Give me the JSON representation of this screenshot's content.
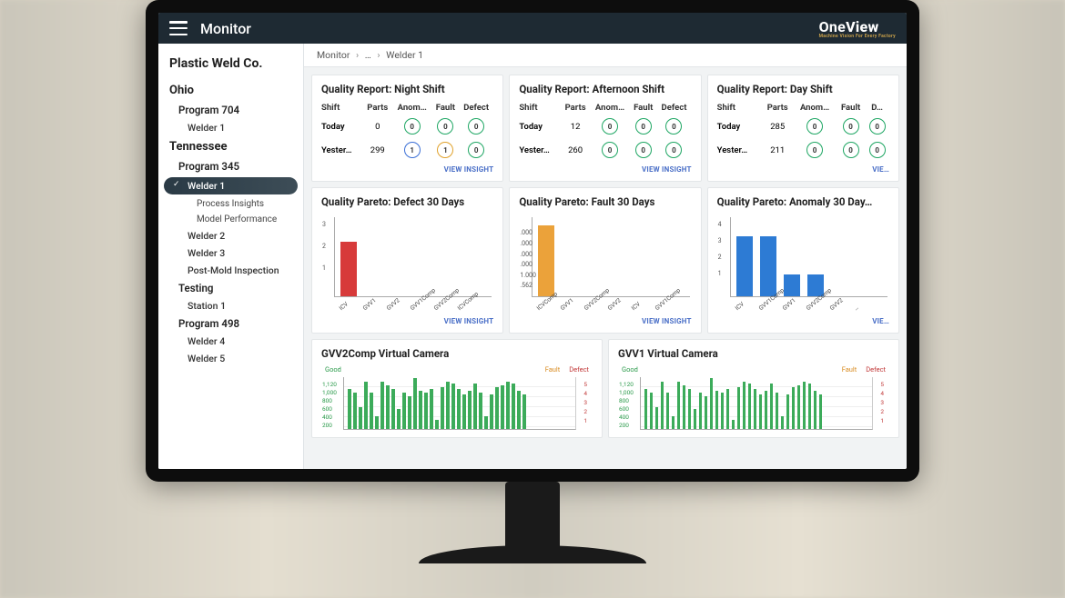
{
  "topbar": {
    "title": "Monitor",
    "brand_prefix": "One",
    "brand_suffix": "View",
    "brand_tag": "Machine Vision For Every Factory"
  },
  "company": "Plastic Weld Co.",
  "tree": {
    "ohio": {
      "label": "Ohio",
      "program704": "Program 704",
      "welder1": "Welder 1"
    },
    "tennessee": {
      "label": "Tennessee",
      "program345": "Program 345",
      "welder1": "Welder 1",
      "process_insights": "Process Insights",
      "model_performance": "Model Performance",
      "welder2": "Welder 2",
      "welder3": "Welder 3",
      "post_mold": "Post-Mold Inspection",
      "testing": "Testing",
      "station1": "Station 1",
      "program498": "Program 498",
      "welder4": "Welder 4",
      "welder5": "Welder 5"
    }
  },
  "breadcrumb": {
    "a": "Monitor",
    "b": "…",
    "c": "Welder 1"
  },
  "quality_reports": [
    {
      "title": "Quality Report: Night Shift",
      "headers": [
        "Shift",
        "Parts",
        "Anom…",
        "Fault",
        "Defect"
      ],
      "rows": [
        {
          "label": "Today",
          "parts": "0",
          "anom": {
            "v": "0",
            "c": "green"
          },
          "fault": {
            "v": "0",
            "c": "green"
          },
          "defect": {
            "v": "0",
            "c": "green"
          }
        },
        {
          "label": "Yester…",
          "parts": "299",
          "anom": {
            "v": "1",
            "c": "blue"
          },
          "fault": {
            "v": "1",
            "c": "amber"
          },
          "defect": {
            "v": "0",
            "c": "green"
          }
        }
      ],
      "link": "VIEW INSIGHT"
    },
    {
      "title": "Quality Report: Afternoon Shift",
      "headers": [
        "Shift",
        "Parts",
        "Anom…",
        "Fault",
        "Defect"
      ],
      "rows": [
        {
          "label": "Today",
          "parts": "12",
          "anom": {
            "v": "0",
            "c": "green"
          },
          "fault": {
            "v": "0",
            "c": "green"
          },
          "defect": {
            "v": "0",
            "c": "green"
          }
        },
        {
          "label": "Yester…",
          "parts": "260",
          "anom": {
            "v": "0",
            "c": "green"
          },
          "fault": {
            "v": "0",
            "c": "green"
          },
          "defect": {
            "v": "0",
            "c": "green"
          }
        }
      ],
      "link": "VIEW INSIGHT"
    },
    {
      "title": "Quality Report: Day Shift",
      "headers": [
        "Shift",
        "Parts",
        "Anom…",
        "Fault",
        "D…"
      ],
      "rows": [
        {
          "label": "Today",
          "parts": "285",
          "anom": {
            "v": "0",
            "c": "green"
          },
          "fault": {
            "v": "0",
            "c": "green"
          },
          "defect": {
            "v": "0",
            "c": "green"
          }
        },
        {
          "label": "Yester…",
          "parts": "211",
          "anom": {
            "v": "0",
            "c": "green"
          },
          "fault": {
            "v": "0",
            "c": "green"
          },
          "defect": {
            "v": "0",
            "c": "green"
          }
        }
      ],
      "link": "VIE…"
    }
  ],
  "paretos": [
    {
      "title": "Quality Pareto: Defect 30 Days",
      "yticks": [
        "3",
        "2",
        "1"
      ],
      "bars": [
        {
          "label": "ICV",
          "h": 60,
          "color": "#d73a3a"
        },
        {
          "label": "GVV1",
          "h": 0
        },
        {
          "label": "GVV2",
          "h": 0
        },
        {
          "label": "GVV1Comp",
          "h": 0
        },
        {
          "label": "GVV2Comp",
          "h": 0
        },
        {
          "label": "ICVComp",
          "h": 0
        }
      ],
      "link": "VIEW INSIGHT"
    },
    {
      "title": "Quality Pareto: Fault 30 Days",
      "yticks": [
        ".562",
        "1.000",
        ".000",
        ".000",
        ".000",
        ".000"
      ],
      "bars": [
        {
          "label": "ICVComp",
          "h": 78,
          "color": "#eba23a"
        },
        {
          "label": "GVV1",
          "h": 0
        },
        {
          "label": "GVV2Comp",
          "h": 0
        },
        {
          "label": "GVV2",
          "h": 0
        },
        {
          "label": "ICV",
          "h": 0
        },
        {
          "label": "GVV1Comp",
          "h": 0
        }
      ],
      "link": "VIEW INSIGHT"
    },
    {
      "title": "Quality Pareto: Anomaly 30 Day…",
      "yticks": [
        "4",
        "3",
        "2",
        "1"
      ],
      "bars": [
        {
          "label": "ICV",
          "h": 66,
          "color": "#2d7bd4"
        },
        {
          "label": "GVV1Comp",
          "h": 66,
          "color": "#2d7bd4"
        },
        {
          "label": "GVV1",
          "h": 24,
          "color": "#2d7bd4"
        },
        {
          "label": "GVV2Comp",
          "h": 24,
          "color": "#2d7bd4"
        },
        {
          "label": "GVV2",
          "h": 0
        },
        {
          "label": "…",
          "h": 0
        }
      ],
      "link": "VIE…"
    }
  ],
  "virtual_cameras": [
    {
      "title": "GVV2Comp Virtual Camera",
      "legend": {
        "good": "Good",
        "fault": "Fault",
        "defect": "Defect"
      },
      "yticks_left": [
        "1,120",
        "1,000",
        "800",
        "600",
        "400",
        "200"
      ],
      "yticks_right": [
        "5",
        "4",
        "3",
        "2",
        "1"
      ],
      "bars": [
        44,
        40,
        24,
        52,
        40,
        14,
        52,
        48,
        44,
        22,
        40,
        36,
        56,
        42,
        40,
        44,
        10,
        46,
        52,
        50,
        44,
        38,
        42,
        50,
        40,
        14,
        38,
        46,
        48,
        52,
        50,
        42,
        38
      ]
    },
    {
      "title": "GVV1 Virtual Camera",
      "legend": {
        "good": "Good",
        "fault": "Fault",
        "defect": "Defect"
      },
      "yticks_left": [
        "1,120",
        "1,000",
        "800",
        "600",
        "400",
        "200"
      ],
      "yticks_right": [
        "5",
        "4",
        "3",
        "2",
        "1"
      ],
      "bars": [
        44,
        40,
        24,
        52,
        40,
        14,
        52,
        48,
        44,
        22,
        40,
        36,
        56,
        42,
        40,
        44,
        10,
        46,
        52,
        50,
        44,
        38,
        42,
        50,
        40,
        14,
        38,
        46,
        48,
        52,
        50,
        42,
        38
      ]
    }
  ],
  "chart_data": [
    {
      "type": "bar",
      "title": "Quality Pareto: Defect 30 Days",
      "categories": [
        "ICV",
        "GVV1",
        "GVV2",
        "GVV1Comp",
        "GVV2Comp",
        "ICVComp"
      ],
      "values": [
        2,
        0,
        0,
        0,
        0,
        0
      ],
      "ylim": [
        0,
        3
      ]
    },
    {
      "type": "bar",
      "title": "Quality Pareto: Fault 30 Days",
      "categories": [
        "ICVComp",
        "GVV1",
        "GVV2Comp",
        "GVV2",
        "ICV",
        "GVV1Comp"
      ],
      "values": [
        1.0,
        0,
        0,
        0,
        0,
        0
      ],
      "ylim": [
        0,
        1.2
      ]
    },
    {
      "type": "bar",
      "title": "Quality Pareto: Anomaly 30 Days",
      "categories": [
        "ICV",
        "GVV1Comp",
        "GVV1",
        "GVV2Comp",
        "GVV2"
      ],
      "values": [
        3,
        3,
        1,
        1,
        0
      ],
      "ylim": [
        0,
        4
      ]
    },
    {
      "type": "bar",
      "title": "GVV2Comp Virtual Camera",
      "series": [
        {
          "name": "Good",
          "values": [
            880,
            800,
            480,
            1040,
            800,
            280,
            1040,
            960,
            880,
            440,
            800,
            720,
            1120,
            840,
            800,
            880,
            200,
            920,
            1040,
            1000,
            880,
            760,
            840,
            1000,
            800,
            280,
            760,
            920,
            960,
            1040,
            1000,
            840,
            760
          ]
        }
      ],
      "ylim": [
        0,
        1120
      ],
      "y2lim": [
        0,
        5
      ],
      "y2series": [
        "Fault",
        "Defect"
      ]
    },
    {
      "type": "bar",
      "title": "GVV1 Virtual Camera",
      "series": [
        {
          "name": "Good",
          "values": [
            880,
            800,
            480,
            1040,
            800,
            280,
            1040,
            960,
            880,
            440,
            800,
            720,
            1120,
            840,
            800,
            880,
            200,
            920,
            1040,
            1000,
            880,
            760,
            840,
            1000,
            800,
            280,
            760,
            920,
            960,
            1040,
            1000,
            840,
            760
          ]
        }
      ],
      "ylim": [
        0,
        1120
      ],
      "y2lim": [
        0,
        5
      ],
      "y2series": [
        "Fault",
        "Defect"
      ]
    }
  ]
}
